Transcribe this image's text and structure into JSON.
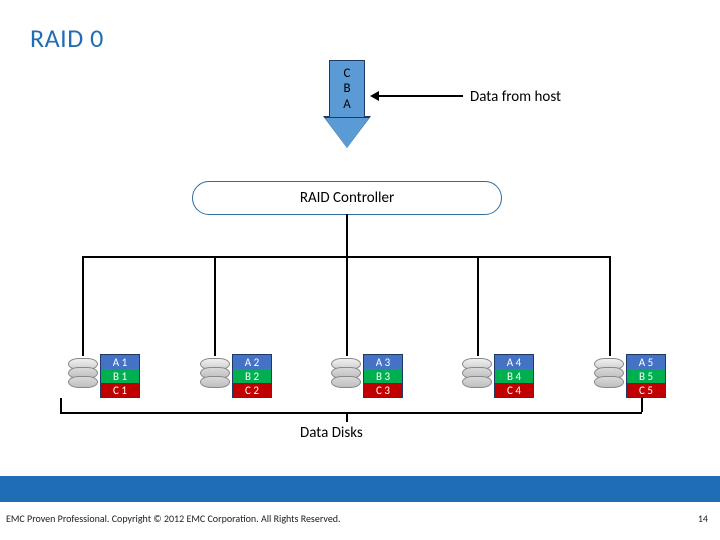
{
  "title": "RAID 0",
  "arrow_labels": {
    "top": "C",
    "mid": "B",
    "bot": "A"
  },
  "host_label": "Data from host",
  "controller": "RAID Controller",
  "disks": [
    {
      "a": "A 1",
      "b": "B 1",
      "c": "C 1"
    },
    {
      "a": "A 2",
      "b": "B 2",
      "c": "C 2"
    },
    {
      "a": "A 3",
      "b": "B 3",
      "c": "C 3"
    },
    {
      "a": "A 4",
      "b": "B 4",
      "c": "C 4"
    },
    {
      "a": "A 5",
      "b": "B 5",
      "c": "C 5"
    }
  ],
  "data_disks_label": "Data Disks",
  "footer": "EMC Proven Professional. Copyright © 2012 EMC Corporation. All Rights Reserved.",
  "page": "14"
}
